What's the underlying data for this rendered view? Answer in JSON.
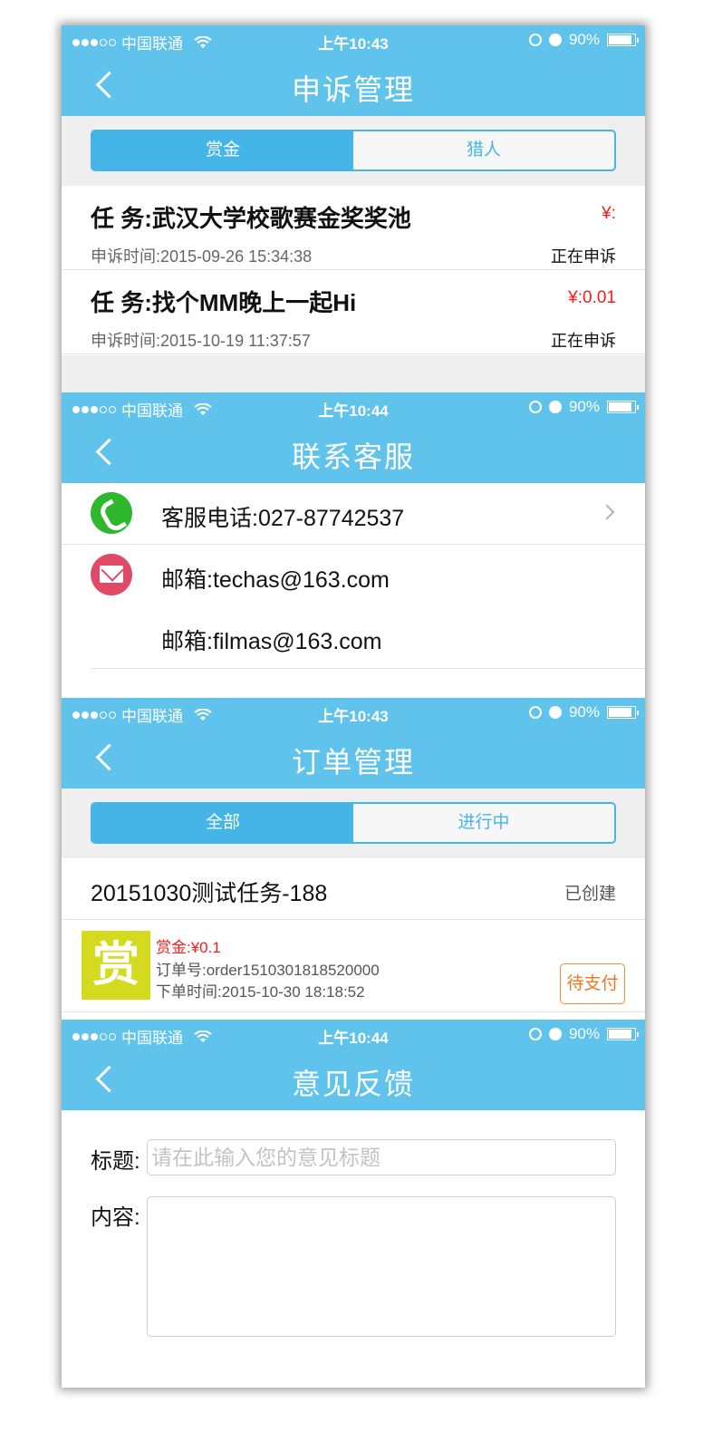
{
  "status_bar_common": {
    "carrier": "中国联通",
    "battery": "90%",
    "battery_level": 0.9
  },
  "colors": {
    "nav": "#5fc3ec",
    "segment": "#45b5e7",
    "price": "#ff1a1a",
    "pay": "#f07820",
    "phone_icon": "#2fb72d",
    "mail_icon": "#e04a67",
    "reward_img": "#d4da1d"
  },
  "screen_appeal": {
    "time": "上午10:43",
    "title": "申诉管理",
    "tabs": [
      {
        "label": "赏金",
        "active": true
      },
      {
        "label": "猎人",
        "active": false
      }
    ],
    "items": [
      {
        "title": "任  务:武汉大学校歌赛金奖奖池",
        "amount": "¥:",
        "time": "申诉时间:2015-09-26 15:34:38",
        "status": "正在申诉"
      },
      {
        "title": "任  务:找个MM晚上一起Hi",
        "amount": "¥:0.01",
        "time": "申诉时间:2015-10-19 11:37:57",
        "status": "正在申诉"
      }
    ]
  },
  "screen_contact": {
    "time": "上午10:44",
    "title": "联系客服",
    "phone": "客服电话:027-87742537",
    "emails": [
      "邮箱:techas@163.com",
      "邮箱:filmas@163.com"
    ],
    "icons": {
      "phone": "phone-icon",
      "mail": "mail-icon"
    }
  },
  "screen_orders": {
    "time": "上午10:43",
    "title": "订单管理",
    "tabs": [
      {
        "label": "全部",
        "active": true
      },
      {
        "label": "进行中",
        "active": false
      }
    ],
    "order": {
      "name": "20151030测试任务-188",
      "status": "已创建",
      "image_char": "赏",
      "reward": "赏金:¥0.1",
      "order_no": "订单号:order1510301818520000",
      "order_time": "下单时间:2015-10-30 18:18:52",
      "action": "待支付"
    }
  },
  "screen_feedback": {
    "time": "上午10:44",
    "title": "意见反馈",
    "title_label": "标题:",
    "title_placeholder": "请在此输入您的意见标题",
    "content_label": "内容:"
  }
}
